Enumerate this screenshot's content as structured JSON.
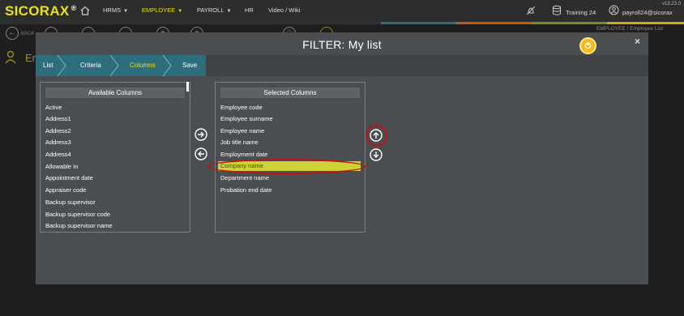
{
  "app": {
    "logo": "SICORAX",
    "logo_mark": "®",
    "version": "v13.23.0"
  },
  "nav": {
    "hrms": "HRMS",
    "employee": "EMPLOYEE",
    "payroll": "PAYROLL",
    "hr": "HR",
    "video_wiki": "Video / Wiki",
    "training": "Training 24",
    "user": "payroll24@sicorax"
  },
  "toolbar": {
    "back_label": "BACK",
    "breadcrumb": "EMPLOYEE / Employee List",
    "page_title": "En"
  },
  "modal": {
    "title": "FILTER: My list",
    "close": "×",
    "steps": [
      "List",
      "Criteria",
      "Columns",
      "Save"
    ],
    "available": {
      "header": "Available Columns",
      "items": [
        "Active",
        "Address1",
        "Address2",
        "Address3",
        "Address4",
        "Allowable In",
        "Appointment date",
        "Appraiser code",
        "Backup supervisor",
        "Backup supervisor code",
        "Backup supervisor name"
      ]
    },
    "selected": {
      "header": "Selected Columns",
      "items": [
        "Employee code",
        "Employee surname",
        "Employee name",
        "Job title name",
        "Employment date",
        "Company name",
        "Department name",
        "Probation end date"
      ],
      "highlighted_index": 5
    }
  },
  "colors": {
    "accent": "#e9e40f",
    "wizard_active": "#2d6e7e",
    "highlight": "#cdd237",
    "annotation": "#c21313"
  }
}
